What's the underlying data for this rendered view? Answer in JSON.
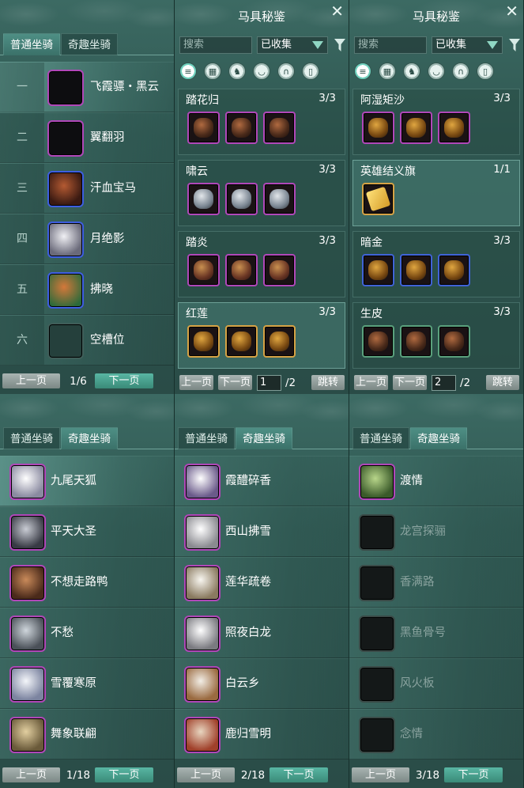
{
  "tabs": {
    "normal": "普通坐骑",
    "fun": "奇趣坐骑"
  },
  "p1": {
    "rows": [
      {
        "num": "一",
        "name": "飞霞骠・黑云"
      },
      {
        "num": "二",
        "name": "翼翻羽"
      },
      {
        "num": "三",
        "name": "汗血宝马"
      },
      {
        "num": "四",
        "name": "月绝影"
      },
      {
        "num": "五",
        "name": "拂晓"
      },
      {
        "num": "六",
        "name": "空槽位"
      }
    ],
    "prev": "上一页",
    "page": "1/6",
    "next": "下一页"
  },
  "p2": {
    "title": "马具秘鉴",
    "search_placeholder": "搜索",
    "filter": "已收集",
    "sets": [
      {
        "name": "踏花归",
        "count": "3/3"
      },
      {
        "name": "啸云",
        "count": "3/3"
      },
      {
        "name": "踏炎",
        "count": "3/3"
      },
      {
        "name": "红莲",
        "count": "3/3"
      }
    ],
    "prev": "上一页",
    "next": "下一页",
    "page_input": "1",
    "total": "/2",
    "jump": "跳转"
  },
  "p3": {
    "title": "马具秘鉴",
    "search_placeholder": "搜索",
    "filter": "已收集",
    "sets": [
      {
        "name": "阿湿矩沙",
        "count": "3/3"
      },
      {
        "name": "英雄结义旗",
        "count": "1/1"
      },
      {
        "name": "暗金",
        "count": "3/3"
      },
      {
        "name": "生皮",
        "count": "3/3"
      }
    ],
    "prev": "上一页",
    "next": "下一页",
    "page_input": "2",
    "total": "/2",
    "jump": "跳转"
  },
  "p4": {
    "rows": [
      "九尾天狐",
      "平天大圣",
      "不想走路鸭",
      "不愁",
      "雪覆寒原",
      "舞象联翩"
    ],
    "prev": "上一页",
    "page": "1/18",
    "next": "下一页"
  },
  "p5": {
    "rows": [
      "霞醴碎香",
      "西山拂雪",
      "莲华疏卷",
      "照夜白龙",
      "白云乡",
      "鹿归雪明"
    ],
    "prev": "上一页",
    "page": "2/18",
    "next": "下一页"
  },
  "p6": {
    "rows": [
      "渡情",
      "龙宫探骊",
      "香满路",
      "黑鱼骨号",
      "风火板",
      "念情"
    ],
    "prev": "上一页",
    "page": "3/18",
    "next": "下一页"
  },
  "colors": {
    "purple_border": "#b047b8",
    "blue_border": "#3e5ee0",
    "gold_border": "#d6a245",
    "accent": "#3a8a78"
  },
  "icons": [
    "list-icon",
    "grid-icon",
    "horse-head-icon",
    "saddle-icon",
    "horseshoe-icon",
    "stirrup-icon",
    "filter-icon",
    "close-icon"
  ]
}
